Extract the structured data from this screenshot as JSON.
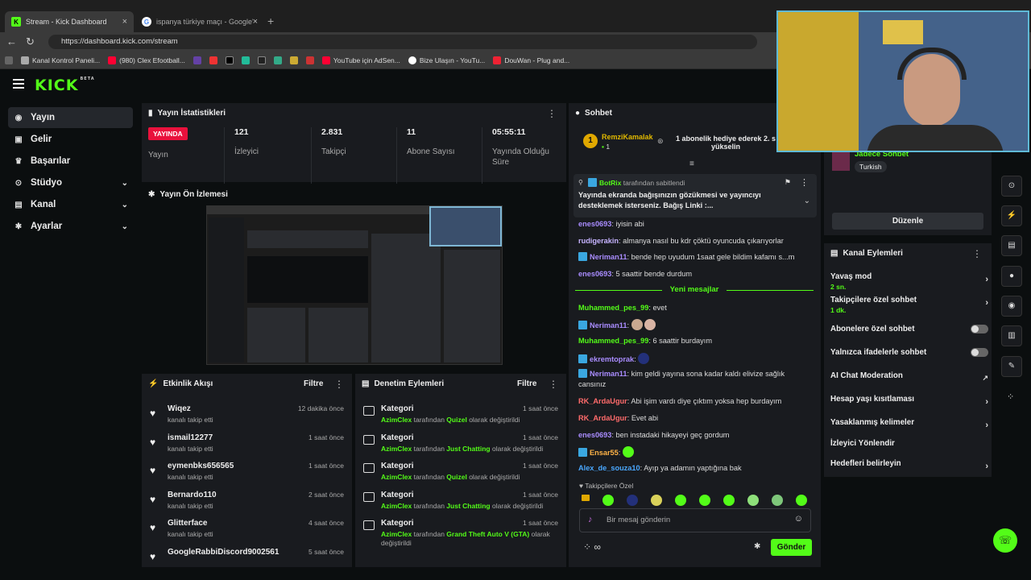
{
  "browser": {
    "tabs": [
      {
        "title": "Stream - Kick Dashboard",
        "active": true
      },
      {
        "title": "ispanya türkiye maçı - Google'da",
        "active": false
      }
    ],
    "url": "https://dashboard.kick.com/stream",
    "bookmarks": [
      "Kanal Kontrol Paneli...",
      "(980) Clex Efootball...",
      "YouTube için AdSen...",
      "Bize Ulaşın - YouTu...",
      "DouWan - Plug and..."
    ]
  },
  "logo": {
    "text": "KICK",
    "badge": "BETA"
  },
  "sidebar": {
    "items": [
      {
        "label": "Yayın",
        "icon": "broadcast-icon"
      },
      {
        "label": "Gelir",
        "icon": "wallet-icon"
      },
      {
        "label": "Başarılar",
        "icon": "trophy-icon"
      },
      {
        "label": "Stüdyo",
        "icon": "studio-icon"
      },
      {
        "label": "Kanal",
        "icon": "channel-icon"
      },
      {
        "label": "Ayarlar",
        "icon": "gear-icon"
      }
    ]
  },
  "stats": {
    "title": "Yayın İstatistikleri",
    "status_badge": "YAYINDA",
    "status_label": "Yayın",
    "viewers": {
      "value": "121",
      "label": "İzleyici"
    },
    "followers": {
      "value": "2.831",
      "label": "Takipçi"
    },
    "subs": {
      "value": "11",
      "label": "Abone Sayısı"
    },
    "uptime": {
      "value": "05:55:11",
      "label": "Yayında Olduğu Süre"
    }
  },
  "preview": {
    "title": "Yayın Ön İzlemesi"
  },
  "activity": {
    "title": "Etkinlik Akışı",
    "filter": "Filtre",
    "items": [
      {
        "name": "Wiqez",
        "sub": "kanalı takip etti",
        "time": "12 dakika önce"
      },
      {
        "name": "ismail12277",
        "sub": "kanalı takip etti",
        "time": "1 saat önce"
      },
      {
        "name": "eymenbks656565",
        "sub": "kanalı takip etti",
        "time": "1 saat önce"
      },
      {
        "name": "Bernardo110",
        "sub": "kanalı takip etti",
        "time": "2 saat önce"
      },
      {
        "name": "Glitterface",
        "sub": "kanalı takip etti",
        "time": "4 saat önce"
      },
      {
        "name": "GoogleRabbiDiscord9002561",
        "sub": "",
        "time": "5 saat önce"
      }
    ]
  },
  "moderation": {
    "title": "Denetim Eylemleri",
    "filter": "Filtre",
    "items": [
      {
        "name": "Kategori",
        "actor": "AzimClex",
        "mid": "tarafından",
        "target": "Quizel",
        "end": "olarak değiştirildi",
        "time": "1 saat önce"
      },
      {
        "name": "Kategori",
        "actor": "AzimClex",
        "mid": "tarafından",
        "target": "Just Chatting",
        "end": "olarak değiştirildi",
        "time": "1 saat önce"
      },
      {
        "name": "Kategori",
        "actor": "AzimClex",
        "mid": "tarafından",
        "target": "Quizel",
        "end": "olarak değiştirildi",
        "time": "1 saat önce"
      },
      {
        "name": "Kategori",
        "actor": "AzimClex",
        "mid": "tarafından",
        "target": "Just Chatting",
        "end": "olarak değiştirildi",
        "time": "1 saat önce"
      },
      {
        "name": "Kategori",
        "actor": "AzimClex",
        "mid": "tarafından",
        "target": "Grand Theft Auto V (GTA)",
        "end": "olarak değiştirildi",
        "time": "1 saat önce"
      }
    ]
  },
  "chat": {
    "title": "Sohbet",
    "gifter": {
      "name": "RemziKamalak",
      "count": "1",
      "rank": "1"
    },
    "gift_text": "1 abonelik hediye ederek 2. s yükselin",
    "pinned": {
      "author": "BotRix",
      "by": "tarafından sabitlendi",
      "text": "Yayında ekranda bağışınızın gözükmesi ve yayıncıyı desteklemek isterseniz. Bağış Linki :..."
    },
    "messages": [
      {
        "user": "enes0693",
        "color": "#a98cff",
        "text": "iyisin abi",
        "badge": false
      },
      {
        "user": "rudigerakin",
        "color": "#c6b3ff",
        "text": "almanya nasıl bu kdr çöktü oyuncuda çıkarıyorlar",
        "badge": false
      },
      {
        "user": "Neriman11",
        "color": "#a98cff",
        "text": "bende hep uyudum 1saat gele bildim kafamı s...m",
        "badge": true
      },
      {
        "user": "enes0693",
        "color": "#a98cff",
        "text": "5 saattir bende durdum",
        "badge": false
      }
    ],
    "new_label": "Yeni mesajlar",
    "new_messages": [
      {
        "user": "Muhammed_pes_99",
        "color": "#53fc18",
        "text": "evet",
        "badge": false
      },
      {
        "user": "Neriman11",
        "color": "#a98cff",
        "text": "",
        "badge": true
      },
      {
        "user": "Muhammed_pes_99",
        "color": "#53fc18",
        "text": "6 saattir burdayım",
        "badge": false
      },
      {
        "user": "ekremtoprak",
        "color": "#a98cff",
        "text": "",
        "badge": true
      },
      {
        "user": "Neriman11",
        "color": "#a98cff",
        "text": "kim geldi yayına sona kadar kaldı elivize sağlık cansınız",
        "badge": true
      },
      {
        "user": "RK_ArdaUgur",
        "color": "#ff6b6b",
        "text": "Abi işim vardı diye çıktım yoksa hep burdayım",
        "badge": false
      },
      {
        "user": "RK_ArdaUgur",
        "color": "#ff6b6b",
        "text": "Evet abi",
        "badge": false
      },
      {
        "user": "enes0693",
        "color": "#a98cff",
        "text": "ben instadaki hikayeyi geç gordum",
        "badge": false
      },
      {
        "user": "Ensar55",
        "color": "#ffb347",
        "text": "",
        "badge": true
      },
      {
        "user": "Alex_de_souza10",
        "color": "#4aa8ff",
        "text": "Ayıp ya adamın yaptığına bak",
        "badge": false
      }
    ],
    "followers_only": "Takipçilere Özel",
    "input_placeholder": "Bir mesaj gönderin",
    "send": "Gönder"
  },
  "right": {
    "stream_tag": "Jadece Sohbet",
    "language": "Turkish",
    "edit": "Düzenle",
    "actions_title": "Kanal Eylemleri",
    "actions": [
      {
        "label": "Yavaş mod",
        "sub": "2 sn.",
        "type": "chevron"
      },
      {
        "label": "Takipçilere özel sohbet",
        "sub": "1 dk.",
        "type": "chevron"
      },
      {
        "label": "Abonelere özel sohbet",
        "sub": "",
        "type": "toggle"
      },
      {
        "label": "Yalnızca ifadelerle sohbet",
        "sub": "",
        "type": "toggle"
      },
      {
        "label": "AI Chat Moderation",
        "sub": "",
        "type": "external"
      },
      {
        "label": "Hesap yaşı kısıtlaması",
        "sub": "",
        "type": "chevron"
      },
      {
        "label": "Yasaklanmış kelimeler",
        "sub": "",
        "type": "chevron"
      },
      {
        "label": "İzleyici Yönlendir",
        "sub": "",
        "type": "none"
      },
      {
        "label": "Hedefleri belirleyin",
        "sub": "",
        "type": "chevron"
      }
    ]
  },
  "colors": {
    "accent": "#53fc18",
    "live": "#e9113c",
    "panel": "#191b1f",
    "background": "#0b0e0f"
  }
}
